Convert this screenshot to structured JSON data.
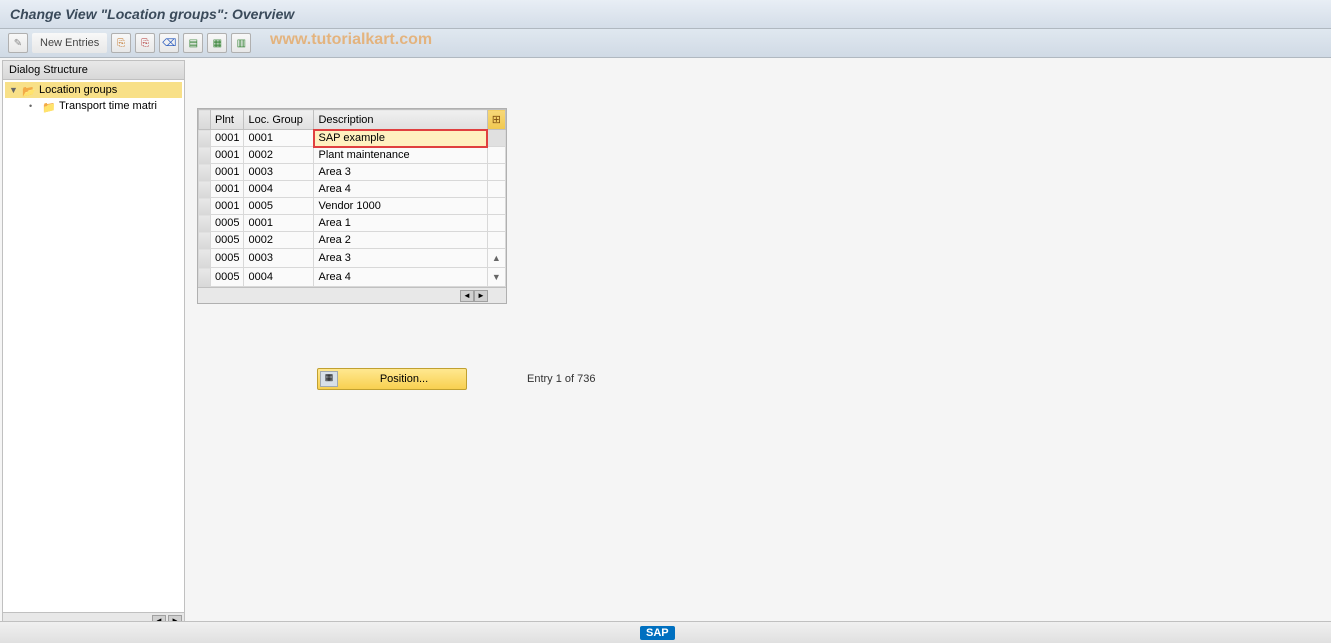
{
  "title": "Change View \"Location groups\": Overview",
  "watermark": "www.tutorialkart.com",
  "toolbar": {
    "new_entries": "New Entries"
  },
  "sidebar": {
    "header": "Dialog Structure",
    "items": [
      {
        "label": "Location groups",
        "level": 0,
        "selected": true,
        "open": true
      },
      {
        "label": "Transport time matri",
        "level": 1,
        "selected": false,
        "open": false
      }
    ]
  },
  "table": {
    "headers": {
      "plnt": "Plnt",
      "loc_group": "Loc. Group",
      "description": "Description"
    },
    "rows": [
      {
        "plnt": "0001",
        "loc_group": "0001",
        "description": "SAP example",
        "edit": true
      },
      {
        "plnt": "0001",
        "loc_group": "0002",
        "description": "Plant maintenance"
      },
      {
        "plnt": "0001",
        "loc_group": "0003",
        "description": "Area 3"
      },
      {
        "plnt": "0001",
        "loc_group": "0004",
        "description": "Area 4"
      },
      {
        "plnt": "0001",
        "loc_group": "0005",
        "description": "Vendor 1000"
      },
      {
        "plnt": "0005",
        "loc_group": "0001",
        "description": "Area 1"
      },
      {
        "plnt": "0005",
        "loc_group": "0002",
        "description": "Area 2"
      },
      {
        "plnt": "0005",
        "loc_group": "0003",
        "description": "Area 3"
      },
      {
        "plnt": "0005",
        "loc_group": "0004",
        "description": "Area 4"
      }
    ]
  },
  "position_button": "Position...",
  "entry_status": "Entry 1 of 736",
  "footer": {
    "logo": "SAP"
  }
}
